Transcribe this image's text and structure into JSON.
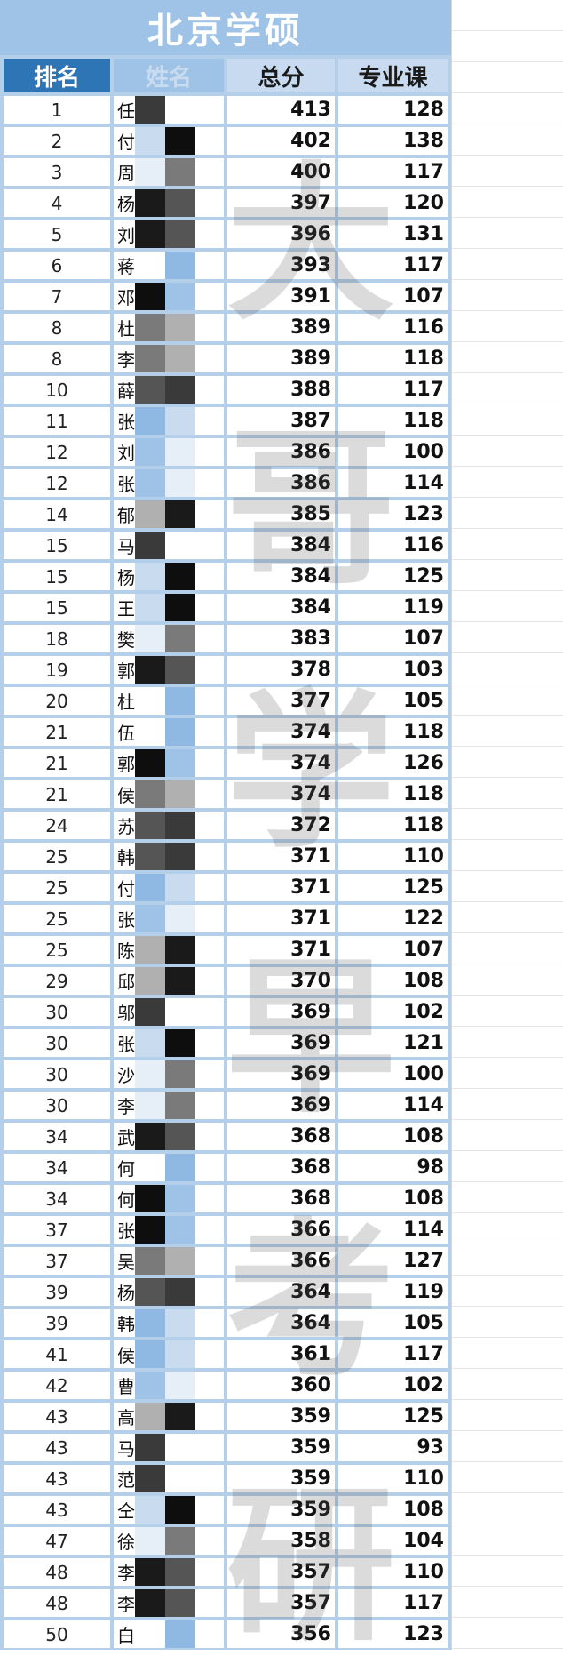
{
  "title": "北京学硕",
  "headers": {
    "rank": "排名",
    "name": "姓名",
    "total": "总分",
    "major": "专业课"
  },
  "watermark": [
    "大",
    "哥",
    "学",
    "早",
    "考",
    "研"
  ],
  "colors": {
    "header_blue": "#2e75b6",
    "light_blue": "#9fc3e7",
    "border": "#b4cfe9"
  },
  "rows": [
    {
      "rank": "1",
      "name": "任",
      "total": "413",
      "major": "128"
    },
    {
      "rank": "2",
      "name": "付",
      "total": "402",
      "major": "138"
    },
    {
      "rank": "3",
      "name": "周",
      "total": "400",
      "major": "117"
    },
    {
      "rank": "4",
      "name": "杨",
      "total": "397",
      "major": "120"
    },
    {
      "rank": "5",
      "name": "刘",
      "total": "396",
      "major": "131"
    },
    {
      "rank": "6",
      "name": "蒋",
      "total": "393",
      "major": "117"
    },
    {
      "rank": "7",
      "name": "邓",
      "total": "391",
      "major": "107"
    },
    {
      "rank": "8",
      "name": "杜",
      "total": "389",
      "major": "116"
    },
    {
      "rank": "8",
      "name": "李",
      "total": "389",
      "major": "118"
    },
    {
      "rank": "10",
      "name": "薛",
      "total": "388",
      "major": "117"
    },
    {
      "rank": "11",
      "name": "张",
      "total": "387",
      "major": "118"
    },
    {
      "rank": "12",
      "name": "刘",
      "total": "386",
      "major": "100"
    },
    {
      "rank": "12",
      "name": "张",
      "total": "386",
      "major": "114"
    },
    {
      "rank": "14",
      "name": "郁",
      "total": "385",
      "major": "123"
    },
    {
      "rank": "15",
      "name": "马",
      "total": "384",
      "major": "116"
    },
    {
      "rank": "15",
      "name": "杨",
      "total": "384",
      "major": "125"
    },
    {
      "rank": "15",
      "name": "王",
      "total": "384",
      "major": "119"
    },
    {
      "rank": "18",
      "name": "樊",
      "total": "383",
      "major": "107"
    },
    {
      "rank": "19",
      "name": "郭",
      "total": "378",
      "major": "103"
    },
    {
      "rank": "20",
      "name": "杜",
      "total": "377",
      "major": "105"
    },
    {
      "rank": "21",
      "name": "伍",
      "total": "374",
      "major": "118"
    },
    {
      "rank": "21",
      "name": "郭",
      "total": "374",
      "major": "126"
    },
    {
      "rank": "21",
      "name": "侯",
      "total": "374",
      "major": "118"
    },
    {
      "rank": "24",
      "name": "苏",
      "total": "372",
      "major": "118"
    },
    {
      "rank": "25",
      "name": "韩",
      "total": "371",
      "major": "110"
    },
    {
      "rank": "25",
      "name": "付",
      "total": "371",
      "major": "125"
    },
    {
      "rank": "25",
      "name": "张",
      "total": "371",
      "major": "122"
    },
    {
      "rank": "25",
      "name": "陈",
      "total": "371",
      "major": "107"
    },
    {
      "rank": "29",
      "name": "邱",
      "total": "370",
      "major": "108"
    },
    {
      "rank": "30",
      "name": "邬",
      "total": "369",
      "major": "102"
    },
    {
      "rank": "30",
      "name": "张",
      "total": "369",
      "major": "121"
    },
    {
      "rank": "30",
      "name": "沙",
      "total": "369",
      "major": "100"
    },
    {
      "rank": "30",
      "name": "李",
      "total": "369",
      "major": "114"
    },
    {
      "rank": "34",
      "name": "武",
      "total": "368",
      "major": "108"
    },
    {
      "rank": "34",
      "name": "何",
      "total": "368",
      "major": "98"
    },
    {
      "rank": "34",
      "name": "何",
      "total": "368",
      "major": "108"
    },
    {
      "rank": "37",
      "name": "张",
      "total": "366",
      "major": "114"
    },
    {
      "rank": "37",
      "name": "吴",
      "total": "366",
      "major": "127"
    },
    {
      "rank": "39",
      "name": "杨",
      "total": "364",
      "major": "119"
    },
    {
      "rank": "39",
      "name": "韩",
      "total": "364",
      "major": "105"
    },
    {
      "rank": "41",
      "name": "侯",
      "total": "361",
      "major": "117"
    },
    {
      "rank": "42",
      "name": "曹",
      "total": "360",
      "major": "102"
    },
    {
      "rank": "43",
      "name": "高",
      "total": "359",
      "major": "125"
    },
    {
      "rank": "43",
      "name": "马",
      "total": "359",
      "major": "93"
    },
    {
      "rank": "43",
      "name": "范",
      "total": "359",
      "major": "110"
    },
    {
      "rank": "43",
      "name": "仝",
      "total": "359",
      "major": "108"
    },
    {
      "rank": "47",
      "name": "徐",
      "total": "358",
      "major": "104"
    },
    {
      "rank": "48",
      "name": "李",
      "total": "357",
      "major": "110"
    },
    {
      "rank": "48",
      "name": "李",
      "total": "357",
      "major": "117"
    },
    {
      "rank": "50",
      "name": "白",
      "total": "356",
      "major": "123"
    }
  ]
}
